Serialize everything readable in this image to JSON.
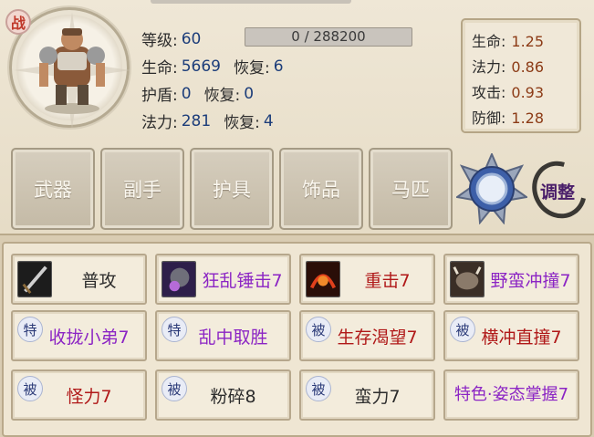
{
  "character": {
    "war_badge": "战",
    "level_label": "等级:",
    "level_value": "60",
    "exp_text": "0 / 288200",
    "exp_progress": 0,
    "hp_label": "生命:",
    "hp_value": "5669",
    "hp_regen_label": "恢复:",
    "hp_regen_value": "6",
    "shield_label": "护盾:",
    "shield_value": "0",
    "shield_regen_label": "恢复:",
    "shield_regen_value": "0",
    "mp_label": "法力:",
    "mp_value": "281",
    "mp_regen_label": "恢复:",
    "mp_regen_value": "4"
  },
  "bonus": [
    {
      "label": "生命:",
      "value": "1.25"
    },
    {
      "label": "法力:",
      "value": "0.86"
    },
    {
      "label": "攻击:",
      "value": "0.93"
    },
    {
      "label": "防御:",
      "value": "1.28"
    }
  ],
  "equipment": [
    "武器",
    "副手",
    "护具",
    "饰品",
    "马匹"
  ],
  "adjust_label": "调整",
  "skills": [
    {
      "name": "普攻",
      "tag": "",
      "icon": "sword-icon",
      "color": "plain"
    },
    {
      "name": "狂乱锤击7",
      "tag": "",
      "icon": "hammer-icon",
      "color": "purple"
    },
    {
      "name": "重击7",
      "tag": "",
      "icon": "heavy-strike-icon",
      "color": "red"
    },
    {
      "name": "野蛮冲撞7",
      "tag": "",
      "icon": "boar-icon",
      "color": "purple"
    },
    {
      "name": "收拢小弟7",
      "tag": "特",
      "icon": "",
      "color": "purple"
    },
    {
      "name": "乱中取胜",
      "tag": "特",
      "icon": "",
      "color": "purple"
    },
    {
      "name": "生存渴望7",
      "tag": "被",
      "icon": "",
      "color": "red"
    },
    {
      "name": "横冲直撞7",
      "tag": "被",
      "icon": "",
      "color": "red"
    },
    {
      "name": "怪力7",
      "tag": "被",
      "icon": "",
      "color": "red"
    },
    {
      "name": "粉碎8",
      "tag": "被",
      "icon": "",
      "color": "plain"
    },
    {
      "name": "蛮力7",
      "tag": "被",
      "icon": "",
      "color": "plain"
    },
    {
      "name": "特色·姿态掌握7",
      "tag": "",
      "icon": "",
      "color": "purple"
    }
  ],
  "colors": {
    "purple": "#8b24c4",
    "red": "#b01818",
    "plain": "#2c2c2c",
    "stat_value": "#1c3d7a",
    "bonus_value": "#8c3b16"
  }
}
